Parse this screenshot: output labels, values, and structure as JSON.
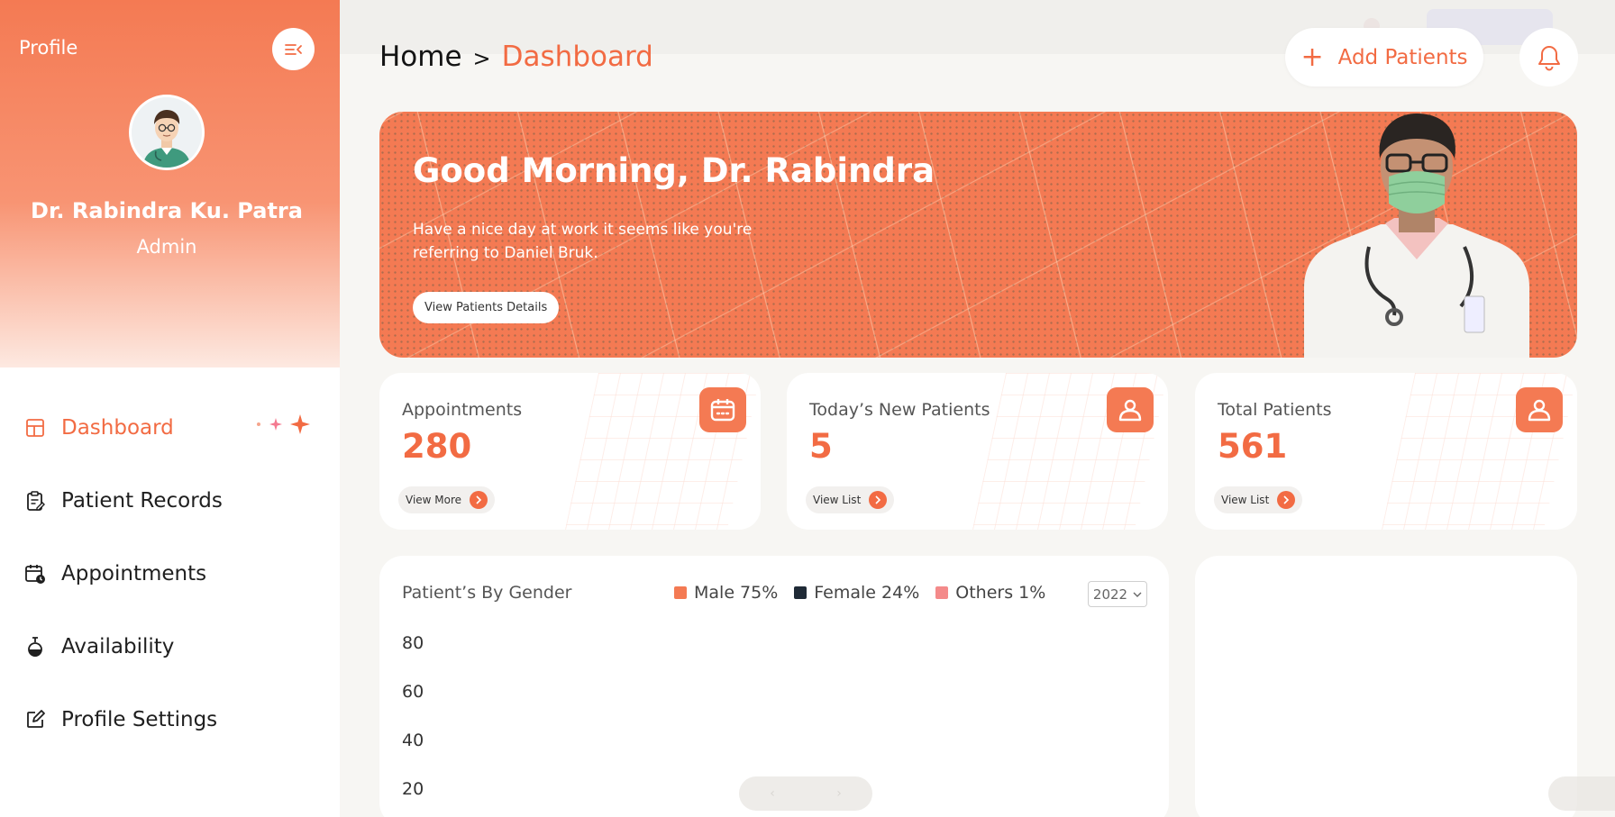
{
  "sidebar": {
    "profile_title": "Profile",
    "doctor_name": "Dr. Rabindra Ku. Patra",
    "doctor_role": "Admin",
    "nav": [
      {
        "label": "Dashboard",
        "icon": "dashboard-icon",
        "active": true
      },
      {
        "label": "Patient Records",
        "icon": "clipboard-icon",
        "active": false
      },
      {
        "label": "Appointments",
        "icon": "calendar-clock-icon",
        "active": false
      },
      {
        "label": "Availability",
        "icon": "timer-icon",
        "active": false
      },
      {
        "label": "Profile Settings",
        "icon": "edit-icon",
        "active": false
      }
    ]
  },
  "header": {
    "breadcrumb_home": "Home",
    "breadcrumb_sep": ">",
    "breadcrumb_current": "Dashboard",
    "add_patients_label": "Add Patients"
  },
  "banner": {
    "greeting": "Good Morning, Dr. Rabindra",
    "subtitle": "Have a nice day at work it seems like you're referring to Daniel Bruk.",
    "button_label": "View Patients Details"
  },
  "stats": [
    {
      "label": "Appointments",
      "value": "280",
      "link": "View More",
      "icon": "calendar-icon"
    },
    {
      "label": "Today’s New Patients",
      "value": "5",
      "link": "View List",
      "icon": "user-icon"
    },
    {
      "label": "Total Patients",
      "value": "561",
      "link": "View List",
      "icon": "user-icon"
    }
  ],
  "gender_chart": {
    "title": "Patient’s By Gender",
    "legend": [
      {
        "label": "Male 75%",
        "color": "#f47a53"
      },
      {
        "label": "Female 24%",
        "color": "#1f2a36"
      },
      {
        "label": "Others 1%",
        "color": "#f48a8a"
      }
    ],
    "year": "2022",
    "y_ticks": [
      "80",
      "60",
      "40",
      "20"
    ]
  },
  "colors": {
    "accent": "#f26b43",
    "banner": "#f47a53",
    "background": "#f7f6f3"
  }
}
